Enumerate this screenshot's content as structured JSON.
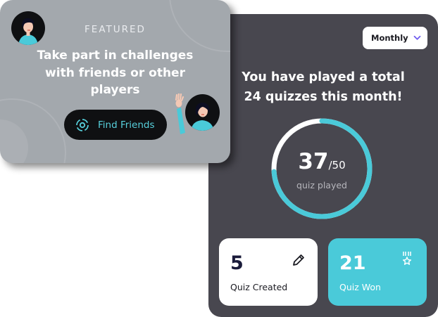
{
  "featured": {
    "label": "FEATURED",
    "text": "Take part in challenges with friends or other players",
    "button_label": "Find Friends"
  },
  "stats": {
    "period_select": "Monthly",
    "played_line1": "You have played a total",
    "played_line2": "24 quizzes this month!",
    "score": "37",
    "score_total": "/50",
    "score_caption": "quiz played",
    "progress_fraction": 0.74,
    "cards": {
      "created": {
        "value": "5",
        "label": "Quiz Created",
        "icon": "pencil-icon"
      },
      "won": {
        "value": "21",
        "label": "Quiz Won",
        "icon": "medal-icon"
      }
    }
  },
  "colors": {
    "accent": "#4acad9",
    "featured_bg": "#a3a8ad",
    "stats_bg": "#48474f",
    "button_bg": "#0f1012"
  }
}
